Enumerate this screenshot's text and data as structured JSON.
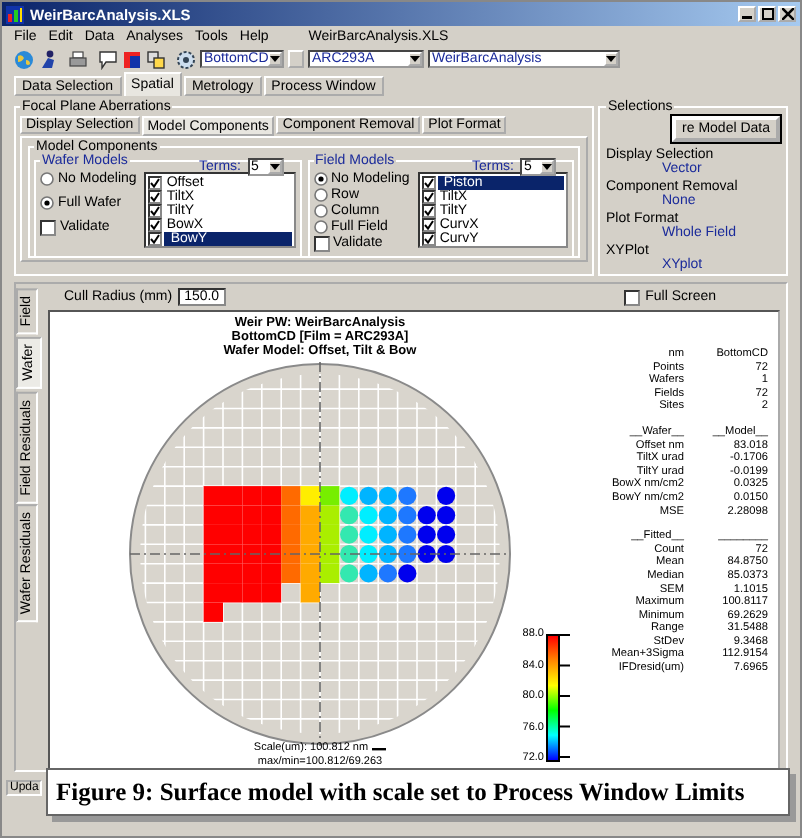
{
  "window": {
    "title": "WeirBarcAnalysis.XLS"
  },
  "menu": {
    "items": [
      "File",
      "Edit",
      "Data",
      "Analyses",
      "Tools",
      "Help"
    ],
    "document": "WeirBarcAnalysis.XLS"
  },
  "toolbar": {
    "combos": [
      {
        "value": "BottomCD"
      },
      {
        "value": "ARC293A"
      },
      {
        "value": "WeirBarcAnalysis"
      }
    ]
  },
  "main_tabs": [
    {
      "label": "Data Selection",
      "selected": false
    },
    {
      "label": "Spatial",
      "selected": true
    },
    {
      "label": "Metrology",
      "selected": false
    },
    {
      "label": "Process Window",
      "selected": false
    }
  ],
  "focal_plane": {
    "title": "Focal Plane Aberrations",
    "tabs": [
      {
        "label": "Display Selection",
        "selected": false
      },
      {
        "label": "Model Components",
        "selected": true
      },
      {
        "label": "Component Removal",
        "selected": false
      },
      {
        "label": "Plot Format",
        "selected": false
      }
    ],
    "group_title": "Model Components",
    "models": [
      {
        "title": "Wafer Models",
        "terms_label": "Terms:",
        "terms": "5",
        "options": [
          {
            "label": "No Modeling",
            "selected": false
          },
          {
            "label": "Full Wafer",
            "selected": true
          }
        ],
        "validate": {
          "label": "Validate",
          "checked": false
        },
        "components": [
          {
            "label": "Offset",
            "checked": true,
            "selected": false
          },
          {
            "label": "TiltX",
            "checked": true,
            "selected": false
          },
          {
            "label": "TiltY",
            "checked": true,
            "selected": false
          },
          {
            "label": "BowX",
            "checked": true,
            "selected": false
          },
          {
            "label": "BowY",
            "checked": true,
            "selected": true
          }
        ]
      },
      {
        "title": "Field Models",
        "terms_label": "Terms:",
        "terms": "5",
        "options": [
          {
            "label": "No Modeling",
            "selected": true
          },
          {
            "label": "Row",
            "selected": false
          },
          {
            "label": "Column",
            "selected": false
          },
          {
            "label": "Full Field",
            "selected": false
          }
        ],
        "validate": {
          "label": "Validate",
          "checked": false
        },
        "components": [
          {
            "label": "Piston",
            "checked": true,
            "selected": true
          },
          {
            "label": "TiltX",
            "checked": true,
            "selected": false
          },
          {
            "label": "TiltY",
            "checked": true,
            "selected": false
          },
          {
            "label": "CurvX",
            "checked": true,
            "selected": false
          },
          {
            "label": "CurvY",
            "checked": true,
            "selected": false
          }
        ]
      }
    ]
  },
  "selections": {
    "title": "Selections",
    "button": "re Model Data",
    "items": [
      {
        "label": "Display Selection",
        "value": "Vector"
      },
      {
        "label": "Component Removal",
        "value": "None"
      },
      {
        "label": "Plot Format",
        "value": "Whole Field"
      },
      {
        "label": "XYPlot",
        "value": "XYplot"
      }
    ]
  },
  "plot": {
    "side_tabs": [
      {
        "label": "Field",
        "selected": false
      },
      {
        "label": "Wafer",
        "selected": true
      },
      {
        "label": "Field Residuals",
        "selected": false
      },
      {
        "label": "Wafer Residuals",
        "selected": false
      }
    ],
    "cull_radius": {
      "label": "Cull Radius (mm)",
      "value": "150.0"
    },
    "full_screen": {
      "label": "Full Screen",
      "checked": false
    },
    "titles": [
      "Weir PW: WeirBarcAnalysis",
      "BottomCD [Film = ARC293A]",
      "Wafer Model: Offset, Tilt & Bow"
    ],
    "scale": [
      "Scale(um): 100.812 nm",
      "max/min=100.812/69.263"
    ],
    "colorbar": {
      "ticks": [
        "88.0",
        "84.0",
        "80.0",
        "76.0",
        "72.0"
      ]
    },
    "stats": [
      [
        {
          "label": "nm",
          "value": "BottomCD"
        },
        {
          "label": "Points",
          "value": "72"
        },
        {
          "label": "Wafers",
          "value": "1"
        },
        {
          "label": "Fields",
          "value": "72"
        },
        {
          "label": "Sites",
          "value": "2"
        }
      ],
      [
        {
          "label": "__Wafer__",
          "value": "__Model__"
        },
        {
          "label": "Offset nm",
          "value": "83.018"
        },
        {
          "label": "TiltX urad",
          "value": "-0.1706"
        },
        {
          "label": "TiltY urad",
          "value": "-0.0199"
        },
        {
          "label": "BowX nm/cm2",
          "value": "0.0325"
        },
        {
          "label": "BowY nm/cm2",
          "value": "0.0150"
        },
        {
          "label": "MSE",
          "value": "2.28098"
        }
      ],
      [
        {
          "label": "__Fitted__",
          "value": "________"
        },
        {
          "label": "Count",
          "value": "72"
        },
        {
          "label": "Mean",
          "value": "84.8750"
        },
        {
          "label": "Median",
          "value": "85.0373"
        },
        {
          "label": "SEM",
          "value": "1.1015"
        },
        {
          "label": "Maximum",
          "value": "100.8117"
        },
        {
          "label": "Minimum",
          "value": "69.2629"
        },
        {
          "label": "Range",
          "value": "31.5488"
        },
        {
          "label": "StDev",
          "value": "9.3468"
        },
        {
          "label": "Mean+3Sigma",
          "value": "112.9154"
        },
        {
          "label": "IFDresid(um)",
          "value": "7.6965"
        }
      ]
    ]
  },
  "status_bar": {
    "text": "Upda"
  },
  "caption": "Figure 9: Surface model with scale set to Process Window Limits"
}
